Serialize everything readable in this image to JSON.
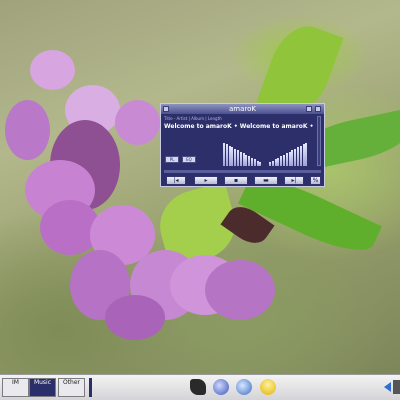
{
  "desktop": {
    "wallpaper": "flower-photo"
  },
  "player": {
    "app_title": "amaroK",
    "playlist_header": "Title - Artist | Album | Length",
    "ticker_text": "Welcome to amaroK  •  Welcome to amaroK  •",
    "btn_pl": "PL",
    "btn_eq": "EQ",
    "time_label": "%",
    "accent_color": "#2c2f6a"
  },
  "taskbar": {
    "pagers": [
      {
        "label": "IM"
      },
      {
        "label": "Music"
      },
      {
        "label": "Other"
      }
    ],
    "icons": [
      "hand-icon",
      "globe-icon",
      "world-icon",
      "user-icon"
    ]
  }
}
